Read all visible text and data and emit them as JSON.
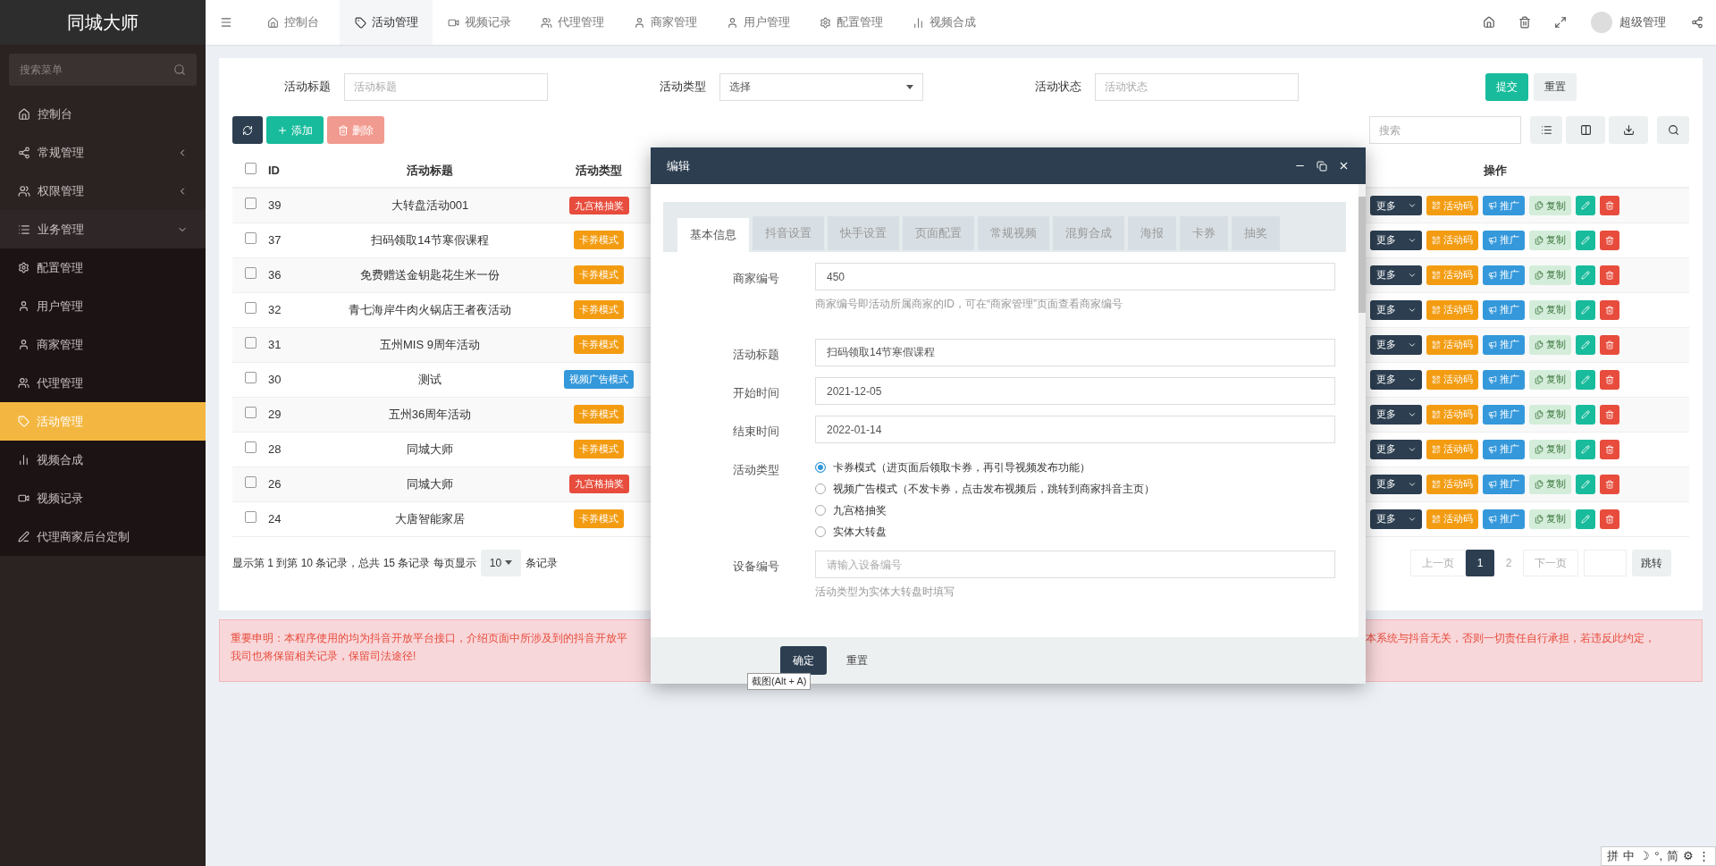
{
  "logo": "同城大师",
  "top_tabs": [
    {
      "label": "控制台",
      "selected": false
    },
    {
      "label": "活动管理",
      "selected": true
    },
    {
      "label": "视频记录",
      "selected": false
    },
    {
      "label": "代理管理",
      "selected": false
    },
    {
      "label": "商家管理",
      "selected": false
    },
    {
      "label": "用户管理",
      "selected": false
    },
    {
      "label": "配置管理",
      "selected": false
    },
    {
      "label": "视频合成",
      "selected": false
    }
  ],
  "user": {
    "name": "超级管理"
  },
  "sidebar": {
    "search_placeholder": "搜索菜单",
    "items": [
      {
        "kind": "link",
        "label": "控制台",
        "selected": false
      },
      {
        "kind": "group",
        "label": "常规管理",
        "expanded": false,
        "selected": false
      },
      {
        "kind": "group",
        "label": "权限管理",
        "expanded": false,
        "selected": false
      },
      {
        "kind": "group",
        "label": "业务管理",
        "expanded": true,
        "selected": false,
        "children": [
          {
            "label": "配置管理",
            "selected": false
          },
          {
            "label": "用户管理",
            "selected": false
          },
          {
            "label": "商家管理",
            "selected": false
          },
          {
            "label": "代理管理",
            "selected": false
          },
          {
            "label": "活动管理",
            "selected": true
          },
          {
            "label": "视频合成",
            "selected": false
          },
          {
            "label": "视频记录",
            "selected": false
          },
          {
            "label": "代理商家后台定制",
            "selected": false
          }
        ]
      }
    ]
  },
  "filters": [
    {
      "kind": "input",
      "label": "活动标题",
      "placeholder": "活动标题"
    },
    {
      "kind": "select",
      "label": "活动类型",
      "value": "选择"
    },
    {
      "kind": "input",
      "label": "活动状态",
      "placeholder": "活动状态"
    }
  ],
  "filter_buttons": [
    "提交",
    "重置"
  ],
  "toolbar": {
    "add": "添加",
    "delete": "删除",
    "search_placeholder": "搜索"
  },
  "table": {
    "select_all_checked": false,
    "columns": [
      "ID",
      "活动标题",
      "活动类型",
      "操作"
    ],
    "rows": [
      {
        "checked": false,
        "id": "39",
        "title": "大转盘活动001",
        "type": {
          "label": "九宫格抽奖",
          "color": "#e74c3c"
        },
        "actions": [
          "更多",
          "活动码",
          "推广",
          "复制"
        ]
      },
      {
        "checked": false,
        "id": "37",
        "title": "扫码领取14节寒假课程",
        "type": {
          "label": "卡券模式",
          "color": "#f39c12"
        },
        "actions": [
          "更多",
          "活动码",
          "推广",
          "复制"
        ]
      },
      {
        "checked": false,
        "id": "36",
        "title": "免费赠送金钥匙花生米一份",
        "type": {
          "label": "卡券模式",
          "color": "#f39c12"
        },
        "actions": [
          "更多",
          "活动码",
          "推广",
          "复制"
        ]
      },
      {
        "checked": false,
        "id": "32",
        "title": "青七海岸牛肉火锅店王者夜活动",
        "type": {
          "label": "卡券模式",
          "color": "#f39c12"
        },
        "actions": [
          "更多",
          "活动码",
          "推广",
          "复制"
        ]
      },
      {
        "checked": false,
        "id": "31",
        "title": "五州MIS 9周年活动",
        "type": {
          "label": "卡券模式",
          "color": "#f39c12"
        },
        "actions": [
          "更多",
          "活动码",
          "推广",
          "复制"
        ]
      },
      {
        "checked": false,
        "id": "30",
        "title": "测试",
        "type": {
          "label": "视频广告模式",
          "color": "#3498db"
        },
        "actions": [
          "更多",
          "活动码",
          "推广",
          "复制"
        ]
      },
      {
        "checked": false,
        "id": "29",
        "title": "五州36周年活动",
        "type": {
          "label": "卡券模式",
          "color": "#f39c12"
        },
        "actions": [
          "更多",
          "活动码",
          "推广",
          "复制"
        ]
      },
      {
        "checked": false,
        "id": "28",
        "title": "同城大师",
        "type": {
          "label": "卡券模式",
          "color": "#f39c12"
        },
        "actions": [
          "更多",
          "活动码",
          "推广",
          "复制"
        ]
      },
      {
        "checked": false,
        "id": "26",
        "title": "同城大师",
        "type": {
          "label": "九宫格抽奖",
          "color": "#e74c3c"
        },
        "actions": [
          "更多",
          "活动码",
          "推广",
          "复制"
        ]
      },
      {
        "checked": false,
        "id": "24",
        "title": "大唐智能家居",
        "type": {
          "label": "卡券模式",
          "color": "#f39c12"
        },
        "actions": [
          "更多",
          "活动码",
          "推广",
          "复制"
        ]
      }
    ]
  },
  "pagination": {
    "summary": "显示第 1 到第 10 条记录，总共 15 条记录 每页显示",
    "page_size": "10",
    "suffix": "条记录",
    "prev": "上一页",
    "pages": [
      {
        "label": "1",
        "selected": true
      },
      {
        "label": "2",
        "selected": false
      }
    ],
    "next": "下一页",
    "jump": "跳转"
  },
  "notice": {
    "left_lines": [
      "重要申明：本程序使用的均为抖音开放平台接口，介绍页面中所涉及到的抖音开放平",
      "我司也将保留相关记录，保留司法途径!"
    ],
    "right_line": "本系统与抖音无关，否则一切责任自行承担，若违反此约定，"
  },
  "modal": {
    "title": "编辑",
    "tabs": [
      {
        "label": "基本信息",
        "selected": true
      },
      {
        "label": "抖音设置",
        "selected": false
      },
      {
        "label": "快手设置",
        "selected": false
      },
      {
        "label": "页面配置",
        "selected": false
      },
      {
        "label": "常规视频",
        "selected": false
      },
      {
        "label": "混剪合成",
        "selected": false
      },
      {
        "label": "海报",
        "selected": false
      },
      {
        "label": "卡券",
        "selected": false
      },
      {
        "label": "抽奖",
        "selected": false
      }
    ],
    "fields": [
      {
        "kind": "input",
        "label": "商家编号",
        "value": "450",
        "help": "商家编号即活动所属商家的ID，可在“商家管理”页面查看商家编号"
      },
      {
        "kind": "input",
        "label": "活动标题",
        "value": "扫码领取14节寒假课程"
      },
      {
        "kind": "input",
        "label": "开始时间",
        "value": "2021-12-05"
      },
      {
        "kind": "input",
        "label": "结束时间",
        "value": "2022-01-14"
      },
      {
        "kind": "radio",
        "label": "活动类型",
        "options": [
          {
            "label": "卡券模式（进页面后领取卡券，再引导视频发布功能）",
            "selected": true
          },
          {
            "label": "视频广告模式（不发卡券，点击发布视频后，跳转到商家抖音主页）",
            "selected": false
          },
          {
            "label": "九宫格抽奖",
            "selected": false
          },
          {
            "label": "实体大转盘",
            "selected": false
          }
        ]
      },
      {
        "kind": "input",
        "label": "设备编号",
        "placeholder": "请输入设备编号",
        "help": "活动类型为实体大转盘时填写"
      }
    ],
    "buttons": [
      {
        "label": "确定",
        "kind": "primary"
      },
      {
        "label": "重置",
        "kind": "plain"
      }
    ],
    "tooltip": "截图(Alt + A)"
  },
  "ime": [
    "拼",
    "中",
    "☽",
    "°,",
    "简",
    "⚙",
    "⋮"
  ]
}
